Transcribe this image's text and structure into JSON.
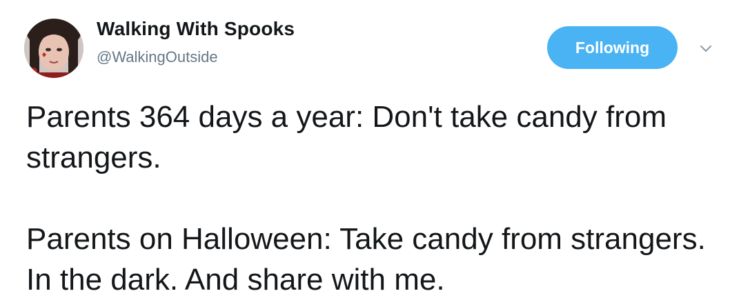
{
  "user": {
    "display_name": "Walking With Spooks",
    "handle": "@WalkingOutside",
    "avatar_icon": "profile-photo"
  },
  "actions": {
    "follow_label": "Following",
    "menu_icon": "chevron-down-icon"
  },
  "tweet": {
    "paragraphs": [
      "Parents 364 days a year: Don't take candy from strangers.",
      "Parents on Halloween: Take candy from strangers. In the dark. And share with me."
    ]
  },
  "colors": {
    "accent": "#4ab3f4",
    "text": "#14171a",
    "secondary_text": "#657786"
  }
}
